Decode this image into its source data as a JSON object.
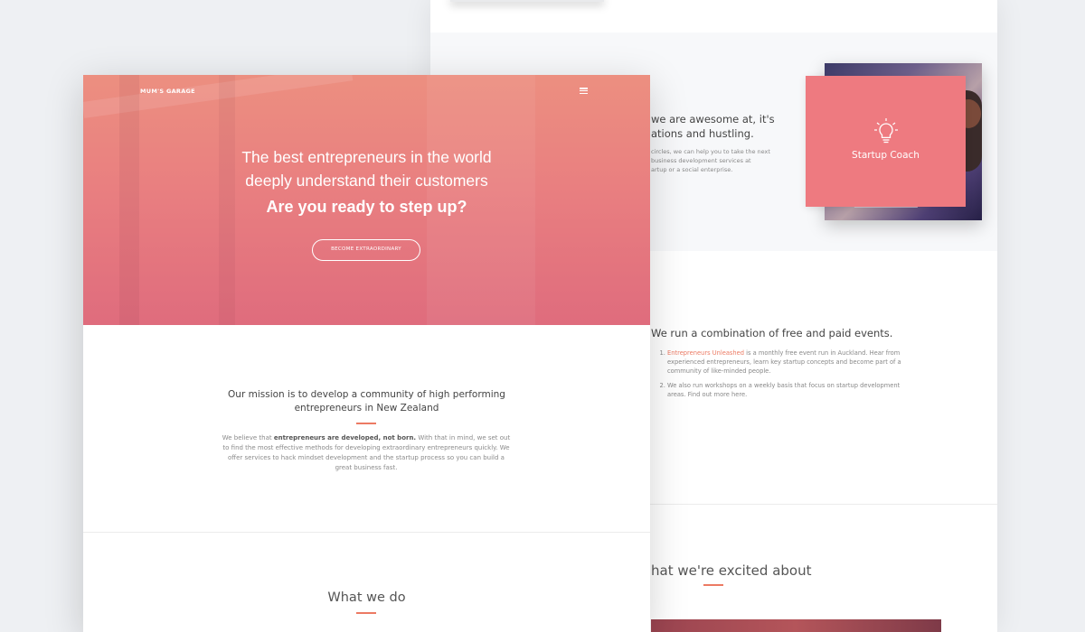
{
  "back_page": {
    "heading": "we are awesome at, it's\nations and hustling.",
    "body": "circles, we can help you to take the next\n business development services at\nartup or a social enterprise.",
    "startup_card": {
      "label": "Startup Coach",
      "icon": "lightbulb-icon"
    },
    "events": {
      "heading": "We run a combination of free and paid events.",
      "items": [
        {
          "link": "Entrepreneurs Unleashed",
          "text": " is a monthly free event run in Auckland. Hear from experienced entrepreneurs, learn key startup concepts and become part of a community of like-minded people."
        },
        {
          "link": "",
          "text": "We also run workshops on a weekly basis that focus on startup development areas. Find out more here."
        }
      ]
    },
    "excited_heading": "hat we're excited about"
  },
  "front_page": {
    "brand": "MUM'S GARAGE",
    "hero": {
      "line1": "The best entrepreneurs in the world",
      "line2": "deeply understand their customers",
      "strong": "Are you ready to step up?",
      "cta": "BECOME EXTRAORDINARY"
    },
    "mission": {
      "title": "Our mission is to develop a community of high performing entrepreneurs in New Zealand",
      "body_prefix": "We believe that ",
      "body_strong": "entrepreneurs are developed, not born.",
      "body_suffix": " With that in mind, we set out to find the most effective methods for developing extraordinary entrepreneurs quickly. We offer services to hack mindset development and the startup process so you can build a great business fast."
    },
    "what_title": "What we do"
  },
  "colors": {
    "accent": "#ec7a63",
    "hero_top": "#ec8f80",
    "hero_bottom": "#df6c7d",
    "card": "#ee7a80"
  }
}
